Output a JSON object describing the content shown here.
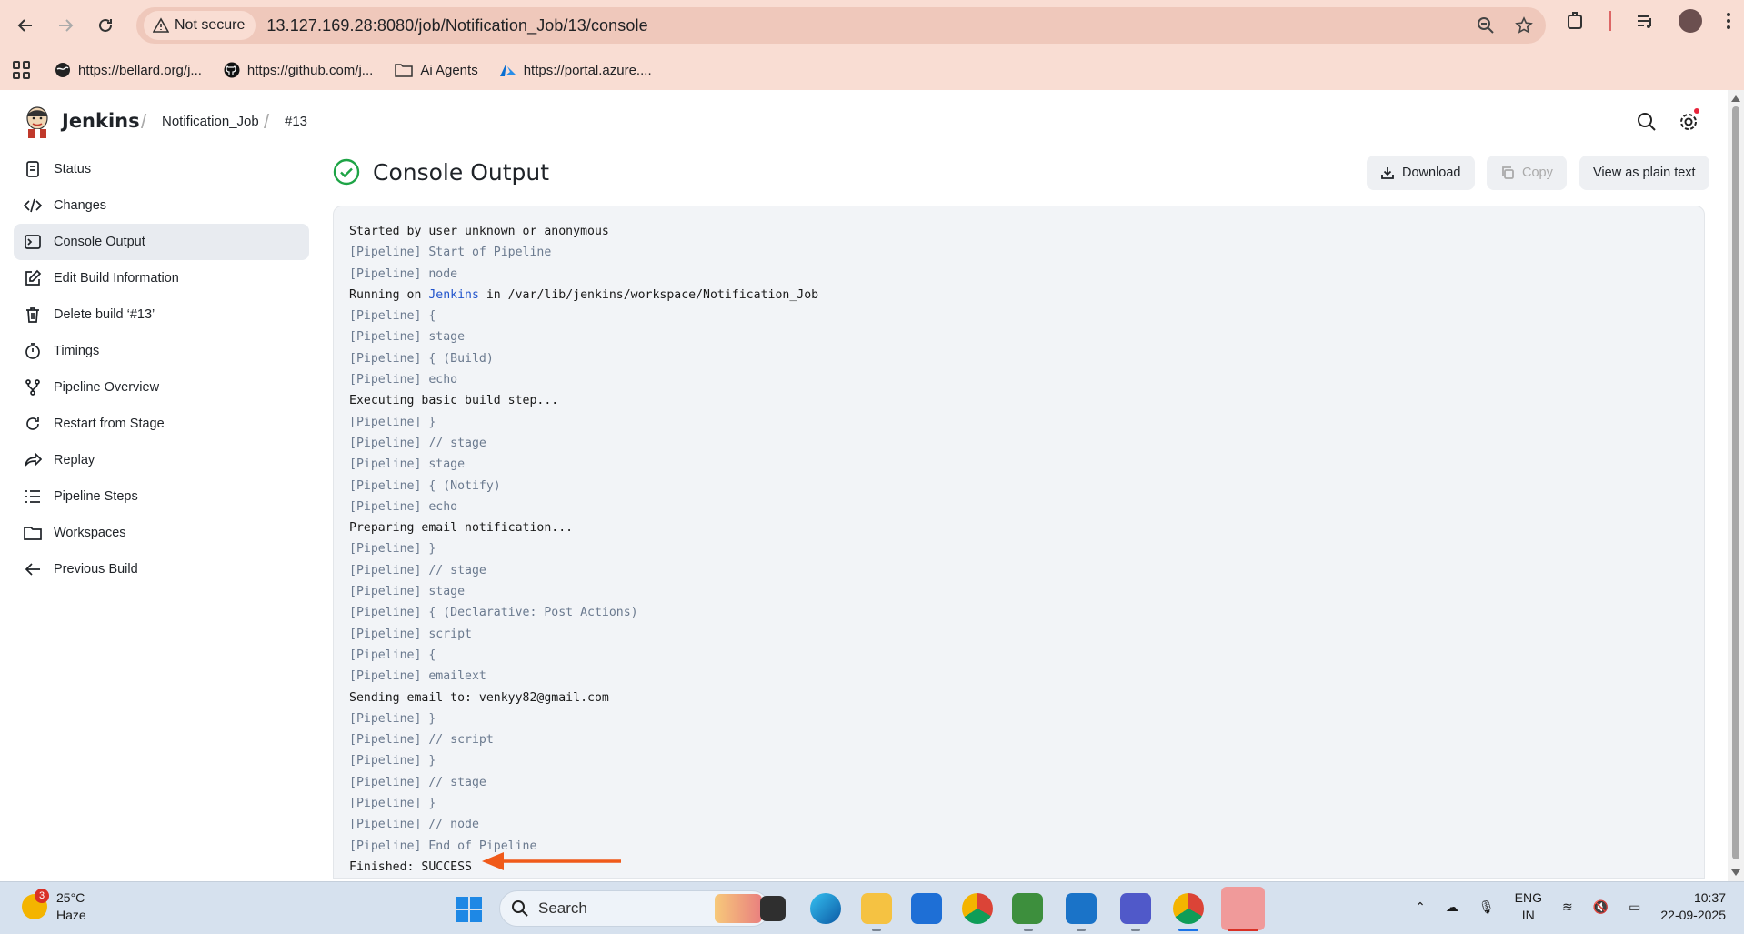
{
  "browser": {
    "not_secure_label": "Not secure",
    "url": "13.127.169.28:8080/job/Notification_Job/13/console",
    "bookmarks": [
      {
        "label": "https://bellard.org/j...",
        "icon": "globe-icon"
      },
      {
        "label": "https://github.com/j...",
        "icon": "github-icon"
      },
      {
        "label": "Ai Agents",
        "icon": "folder-icon"
      },
      {
        "label": "https://portal.azure....",
        "icon": "azure-icon"
      }
    ]
  },
  "jenkins": {
    "brand": "Jenkins",
    "breadcrumbs": [
      "Notification_Job",
      "#13"
    ]
  },
  "sidebar": {
    "items": [
      {
        "label": "Status",
        "icon": "document-icon",
        "active": false
      },
      {
        "label": "Changes",
        "icon": "code-icon",
        "active": false
      },
      {
        "label": "Console Output",
        "icon": "terminal-icon",
        "active": true
      },
      {
        "label": "Edit Build Information",
        "icon": "edit-icon",
        "active": false
      },
      {
        "label": "Delete build ‘#13’",
        "icon": "trash-icon",
        "active": false
      },
      {
        "label": "Timings",
        "icon": "stopwatch-icon",
        "active": false
      },
      {
        "label": "Pipeline Overview",
        "icon": "branch-icon",
        "active": false
      },
      {
        "label": "Restart from Stage",
        "icon": "restart-icon",
        "active": false
      },
      {
        "label": "Replay",
        "icon": "replay-icon",
        "active": false
      },
      {
        "label": "Pipeline Steps",
        "icon": "steps-icon",
        "active": false
      },
      {
        "label": "Workspaces",
        "icon": "folder-icon",
        "active": false
      },
      {
        "label": "Previous Build",
        "icon": "arrow-left-icon",
        "active": false
      }
    ]
  },
  "main": {
    "title": "Console Output",
    "buttons": {
      "download": "Download",
      "copy": "Copy",
      "plain": "View as plain text"
    },
    "console_lines": [
      {
        "segments": [
          {
            "t": "Started by user unknown or anonymous",
            "k": "txt"
          }
        ]
      },
      {
        "segments": [
          {
            "t": "[Pipeline] Start of Pipeline",
            "k": "pl"
          }
        ]
      },
      {
        "segments": [
          {
            "t": "[Pipeline] node",
            "k": "pl"
          }
        ]
      },
      {
        "segments": [
          {
            "t": "Running on ",
            "k": "txt"
          },
          {
            "t": "Jenkins",
            "k": "lnk"
          },
          {
            "t": " in /var/lib/jenkins/workspace/Notification_Job",
            "k": "txt"
          }
        ]
      },
      {
        "segments": [
          {
            "t": "[Pipeline] {",
            "k": "pl"
          }
        ]
      },
      {
        "segments": [
          {
            "t": "[Pipeline] stage",
            "k": "pl"
          }
        ]
      },
      {
        "segments": [
          {
            "t": "[Pipeline] { (Build)",
            "k": "pl"
          }
        ]
      },
      {
        "segments": [
          {
            "t": "[Pipeline] echo",
            "k": "pl"
          }
        ]
      },
      {
        "segments": [
          {
            "t": "Executing basic build step...",
            "k": "txt"
          }
        ]
      },
      {
        "segments": [
          {
            "t": "[Pipeline] }",
            "k": "pl"
          }
        ]
      },
      {
        "segments": [
          {
            "t": "[Pipeline] // stage",
            "k": "pl"
          }
        ]
      },
      {
        "segments": [
          {
            "t": "[Pipeline] stage",
            "k": "pl"
          }
        ]
      },
      {
        "segments": [
          {
            "t": "[Pipeline] { (Notify)",
            "k": "pl"
          }
        ]
      },
      {
        "segments": [
          {
            "t": "[Pipeline] echo",
            "k": "pl"
          }
        ]
      },
      {
        "segments": [
          {
            "t": "Preparing email notification...",
            "k": "txt"
          }
        ]
      },
      {
        "segments": [
          {
            "t": "[Pipeline] }",
            "k": "pl"
          }
        ]
      },
      {
        "segments": [
          {
            "t": "[Pipeline] // stage",
            "k": "pl"
          }
        ]
      },
      {
        "segments": [
          {
            "t": "[Pipeline] stage",
            "k": "pl"
          }
        ]
      },
      {
        "segments": [
          {
            "t": "[Pipeline] { (Declarative: Post Actions)",
            "k": "pl"
          }
        ]
      },
      {
        "segments": [
          {
            "t": "[Pipeline] script",
            "k": "pl"
          }
        ]
      },
      {
        "segments": [
          {
            "t": "[Pipeline] {",
            "k": "pl"
          }
        ]
      },
      {
        "segments": [
          {
            "t": "[Pipeline] emailext",
            "k": "pl"
          }
        ]
      },
      {
        "segments": [
          {
            "t": "Sending email to: venkyy82@gmail.com",
            "k": "txt"
          }
        ]
      },
      {
        "segments": [
          {
            "t": "[Pipeline] }",
            "k": "pl"
          }
        ]
      },
      {
        "segments": [
          {
            "t": "[Pipeline] // script",
            "k": "pl"
          }
        ]
      },
      {
        "segments": [
          {
            "t": "[Pipeline] }",
            "k": "pl"
          }
        ]
      },
      {
        "segments": [
          {
            "t": "[Pipeline] // stage",
            "k": "pl"
          }
        ]
      },
      {
        "segments": [
          {
            "t": "[Pipeline] }",
            "k": "pl"
          }
        ]
      },
      {
        "segments": [
          {
            "t": "[Pipeline] // node",
            "k": "pl"
          }
        ]
      },
      {
        "segments": [
          {
            "t": "[Pipeline] End of Pipeline",
            "k": "pl"
          }
        ]
      },
      {
        "segments": [
          {
            "t": "Finished: SUCCESS",
            "k": "txt"
          }
        ]
      }
    ]
  },
  "taskbar": {
    "weather_badge": "3",
    "temperature": "25°C",
    "condition": "Haze",
    "search_label": "Search",
    "lang_line1": "ENG",
    "lang_line2": "IN",
    "time": "10:37",
    "date": "22-09-2025"
  },
  "colors": {
    "chrome_bg": "#f9ddd3",
    "success": "#1ea446",
    "annotation_arrow": "#f05a1a"
  }
}
